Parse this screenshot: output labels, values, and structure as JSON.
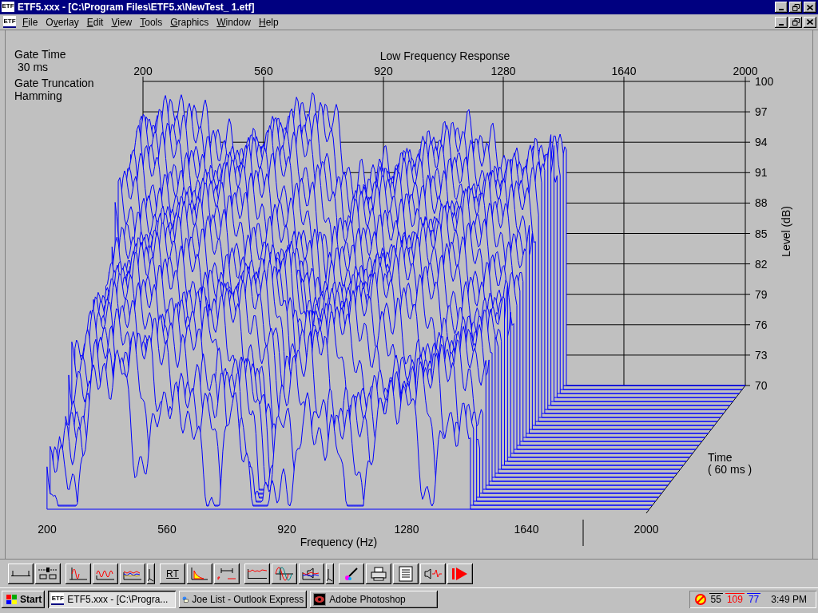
{
  "window": {
    "icon_label": "ETF",
    "title": "ETF5.xxx - [C:\\Program Files\\ETF5.x\\NewTest_ 1.etf]"
  },
  "menu": {
    "icon_label": "ETF",
    "items": [
      {
        "mnemonic": "F",
        "rest": "ile"
      },
      {
        "before": "O",
        "mnemonic": "v",
        "rest": "erlay"
      },
      {
        "mnemonic": "E",
        "rest": "dit"
      },
      {
        "mnemonic": "V",
        "rest": "iew"
      },
      {
        "mnemonic": "T",
        "rest": "ools"
      },
      {
        "mnemonic": "G",
        "rest": "raphics"
      },
      {
        "mnemonic": "W",
        "rest": "indow"
      },
      {
        "mnemonic": "H",
        "rest": "elp"
      }
    ]
  },
  "info": [
    {
      "title": "Gate Time",
      "value": "30 ms"
    },
    {
      "title": "Gate Truncation",
      "value": "Hamming"
    }
  ],
  "chart": {
    "title": "Low Frequency Response",
    "top_ticks": [
      "200",
      "560",
      "920",
      "1280",
      "1640",
      "2000"
    ],
    "bottom_ticks": [
      "200",
      "560",
      "920",
      "1280",
      "1640",
      "2000"
    ],
    "level_ticks": [
      "100",
      "97",
      "94",
      "91",
      "88",
      "85",
      "82",
      "79",
      "76",
      "73",
      "70"
    ],
    "ylabel": "Level (dB)",
    "xlabel": "Frequency (Hz)",
    "time_label": "Time",
    "time_value": "( 60 ms )"
  },
  "toolbar": [
    [
      {
        "kind": "axis"
      },
      {
        "kind": "slider"
      }
    ],
    [
      {
        "kind": "impulse"
      },
      {
        "kind": "wave"
      },
      {
        "kind": "multiwave"
      },
      {
        "kind": "corner"
      }
    ],
    [
      {
        "kind": "text",
        "label": "RT"
      },
      {
        "kind": "decay"
      },
      {
        "kind": "span"
      }
    ],
    [
      {
        "kind": "line"
      },
      {
        "kind": "sine"
      },
      {
        "kind": "speakerchart"
      },
      {
        "kind": "corner"
      }
    ],
    [
      {
        "kind": "pen"
      },
      {
        "kind": "printer"
      },
      {
        "kind": "document"
      },
      {
        "kind": "speaker"
      },
      {
        "kind": "play"
      }
    ]
  ],
  "taskbar": {
    "start": "Start",
    "tasks": [
      {
        "kind": "etf",
        "icon_label": "ETF",
        "label": "ETF5.xxx - [C:\\Progra...",
        "selected": true
      },
      {
        "kind": "mail",
        "label": "Joe List - Outlook Express",
        "selected": false
      },
      {
        "kind": "photo",
        "label": "Adobe Photoshop",
        "selected": false
      }
    ],
    "tray": {
      "readings": [
        {
          "text": "55",
          "color": "#000000"
        },
        {
          "text": "109",
          "color": "#ff0000"
        },
        {
          "text": "77",
          "color": "#0000ff"
        }
      ],
      "clock": "3:49 PM"
    }
  }
}
